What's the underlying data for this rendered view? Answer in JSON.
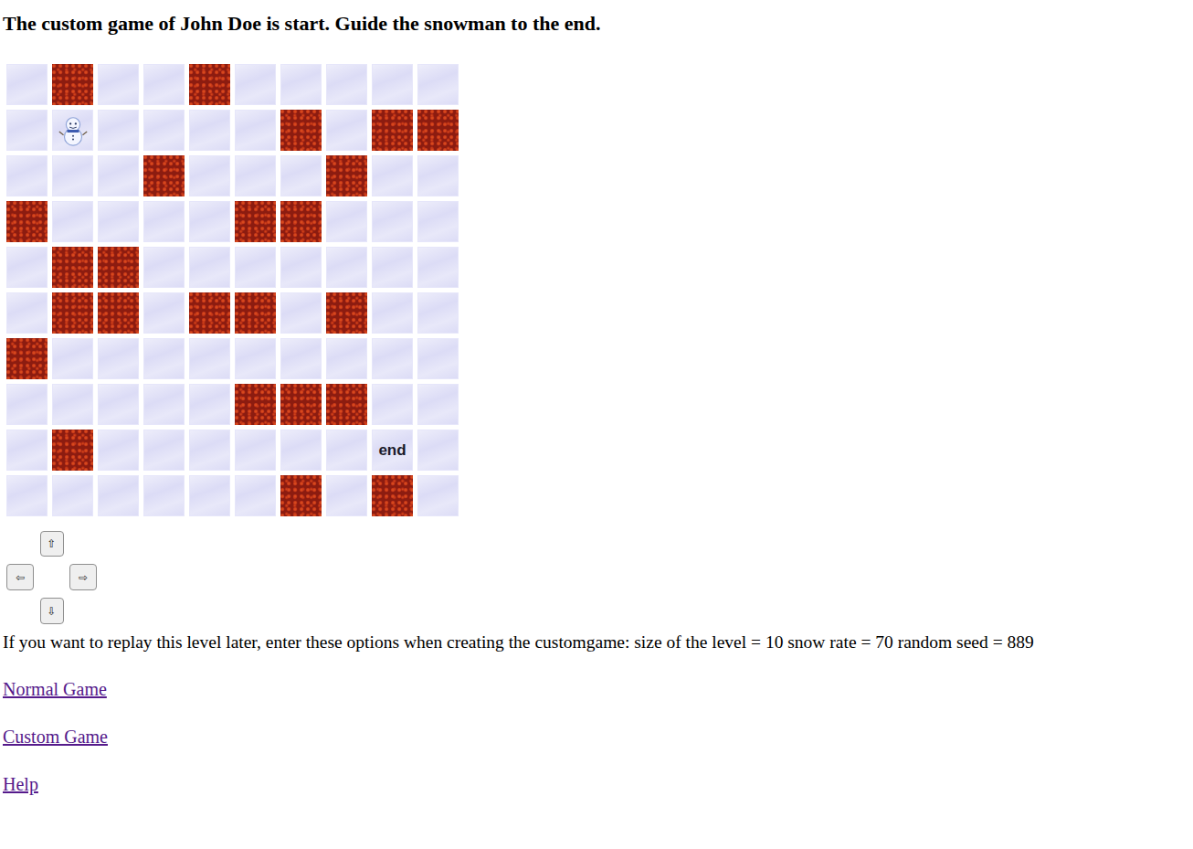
{
  "title": "The custom game of John Doe is start. Guide the snowman to the end.",
  "grid": [
    [
      {
        "kind": "snow"
      },
      {
        "kind": "lava"
      },
      {
        "kind": "snow"
      },
      {
        "kind": "snow"
      },
      {
        "kind": "lava"
      },
      {
        "kind": "snow"
      },
      {
        "kind": "snow"
      },
      {
        "kind": "snow"
      },
      {
        "kind": "snow"
      },
      {
        "kind": "snow"
      }
    ],
    [
      {
        "kind": "snow"
      },
      {
        "kind": "snowman"
      },
      {
        "kind": "snow"
      },
      {
        "kind": "snow"
      },
      {
        "kind": "snow"
      },
      {
        "kind": "snow"
      },
      {
        "kind": "lava"
      },
      {
        "kind": "snow"
      },
      {
        "kind": "lava"
      },
      {
        "kind": "lava"
      }
    ],
    [
      {
        "kind": "snow"
      },
      {
        "kind": "snow"
      },
      {
        "kind": "snow"
      },
      {
        "kind": "lava"
      },
      {
        "kind": "snow"
      },
      {
        "kind": "snow"
      },
      {
        "kind": "snow"
      },
      {
        "kind": "lava"
      },
      {
        "kind": "snow"
      },
      {
        "kind": "snow"
      }
    ],
    [
      {
        "kind": "lava"
      },
      {
        "kind": "snow"
      },
      {
        "kind": "snow"
      },
      {
        "kind": "snow"
      },
      {
        "kind": "snow"
      },
      {
        "kind": "lava"
      },
      {
        "kind": "lava"
      },
      {
        "kind": "snow"
      },
      {
        "kind": "snow"
      },
      {
        "kind": "snow"
      }
    ],
    [
      {
        "kind": "snow"
      },
      {
        "kind": "lava"
      },
      {
        "kind": "lava"
      },
      {
        "kind": "snow"
      },
      {
        "kind": "snow"
      },
      {
        "kind": "snow"
      },
      {
        "kind": "snow"
      },
      {
        "kind": "snow"
      },
      {
        "kind": "snow"
      },
      {
        "kind": "snow"
      }
    ],
    [
      {
        "kind": "snow"
      },
      {
        "kind": "lava"
      },
      {
        "kind": "lava"
      },
      {
        "kind": "snow"
      },
      {
        "kind": "lava"
      },
      {
        "kind": "lava"
      },
      {
        "kind": "snow"
      },
      {
        "kind": "lava"
      },
      {
        "kind": "snow"
      },
      {
        "kind": "snow"
      }
    ],
    [
      {
        "kind": "lava"
      },
      {
        "kind": "snow"
      },
      {
        "kind": "snow"
      },
      {
        "kind": "snow"
      },
      {
        "kind": "snow"
      },
      {
        "kind": "snow"
      },
      {
        "kind": "snow"
      },
      {
        "kind": "snow"
      },
      {
        "kind": "snow"
      },
      {
        "kind": "snow"
      }
    ],
    [
      {
        "kind": "snow"
      },
      {
        "kind": "snow"
      },
      {
        "kind": "snow"
      },
      {
        "kind": "snow"
      },
      {
        "kind": "snow"
      },
      {
        "kind": "lava"
      },
      {
        "kind": "lava"
      },
      {
        "kind": "lava"
      },
      {
        "kind": "snow"
      },
      {
        "kind": "snow"
      }
    ],
    [
      {
        "kind": "snow"
      },
      {
        "kind": "lava"
      },
      {
        "kind": "snow"
      },
      {
        "kind": "snow"
      },
      {
        "kind": "snow"
      },
      {
        "kind": "snow"
      },
      {
        "kind": "snow"
      },
      {
        "kind": "snow"
      },
      {
        "kind": "end",
        "label": "end"
      },
      {
        "kind": "snow"
      }
    ],
    [
      {
        "kind": "snow"
      },
      {
        "kind": "snow"
      },
      {
        "kind": "snow"
      },
      {
        "kind": "snow"
      },
      {
        "kind": "snow"
      },
      {
        "kind": "snow"
      },
      {
        "kind": "lava"
      },
      {
        "kind": "snow"
      },
      {
        "kind": "lava"
      },
      {
        "kind": "snow"
      }
    ]
  ],
  "controls": {
    "up": "⇧",
    "left": "⇦",
    "right": "⇨",
    "down": "⇩"
  },
  "replay_text": "If you want to replay this level later, enter these options when creating the customgame: size of the level = 10 snow rate = 70 random seed = 889",
  "links": [
    "Normal Game",
    "Custom Game",
    "Help"
  ]
}
